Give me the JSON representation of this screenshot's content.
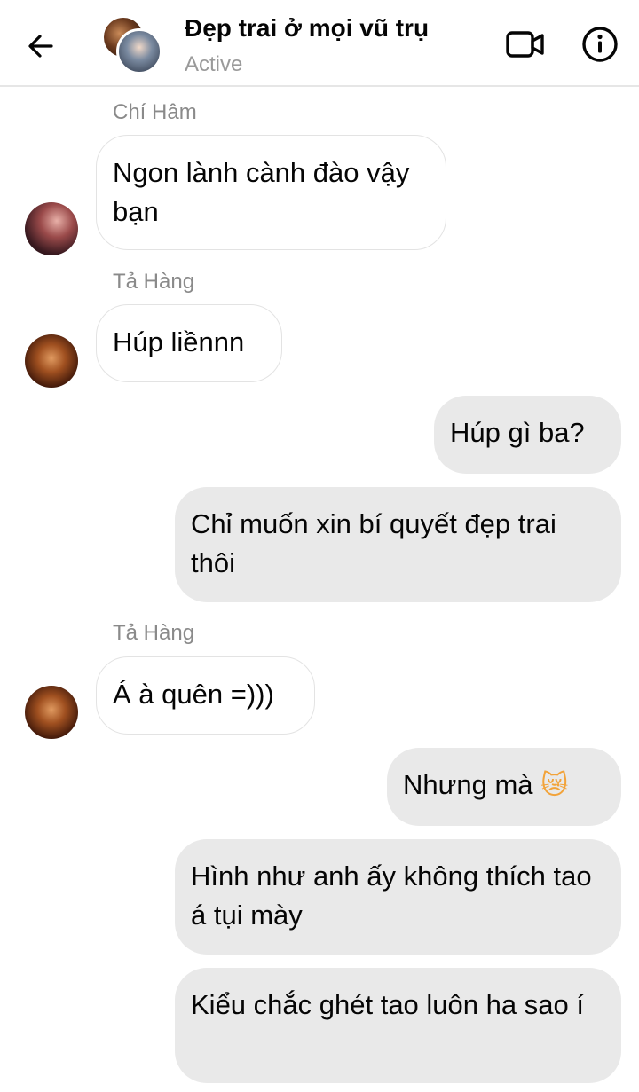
{
  "header": {
    "title": "Đẹp trai ở mọi vũ trụ",
    "status": "Active",
    "back_icon": "arrow-left-icon",
    "video_icon": "video-camera-icon",
    "info_icon": "info-icon"
  },
  "messages": [
    {
      "sender": "Chí Hâm",
      "text": "Ngon lành cành đào vậy bạn",
      "direction": "incoming"
    },
    {
      "sender": "Tả Hàng",
      "text": "Húp liềnnn",
      "direction": "incoming"
    },
    {
      "text": "Húp gì ba?",
      "direction": "outgoing"
    },
    {
      "text": "Chỉ muốn xin bí quyết đẹp trai thôi",
      "direction": "outgoing"
    },
    {
      "sender": "Tả Hàng",
      "text": "Á à quên =)))",
      "direction": "incoming"
    },
    {
      "text": "Nhưng mà",
      "emoji": "😿",
      "direction": "outgoing"
    },
    {
      "text": "Hình như anh ấy không thích tao á tụi mày",
      "direction": "outgoing"
    },
    {
      "text": "Kiểu chắc ghét tao luôn ha sao í",
      "direction": "outgoing"
    }
  ],
  "colors": {
    "incoming_bubble": "#ffffff",
    "outgoing_bubble": "#e9e9e9",
    "sender_name": "#8a8a8a",
    "status": "#9a9a9a"
  }
}
